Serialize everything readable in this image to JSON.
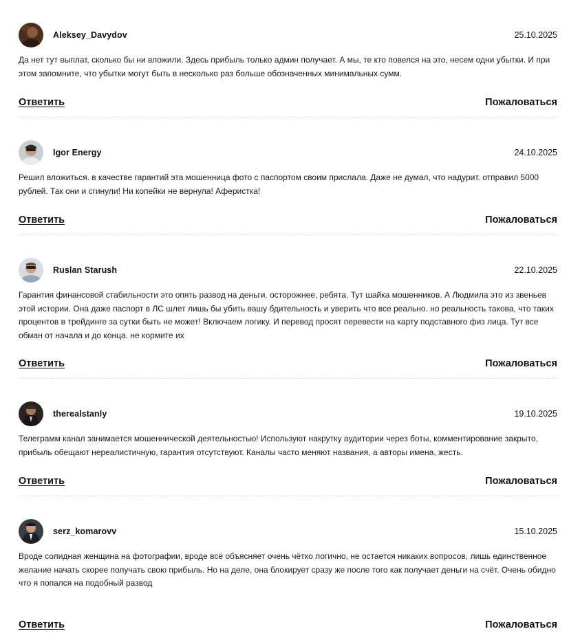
{
  "comments": [
    {
      "username": "Aleksey_Davydov",
      "date": "25.10.2025",
      "text": "Да нет тут выплат, сколько бы ни вложили. Здесь прибыль только админ получает. А мы, те кто повелся на это, несем одни убытки. И при этом запомните, что убытки могут быть в несколько раз больше обозначенных минимальных сумм.",
      "reply_label": "Ответить",
      "report_label": "Пожаловаться"
    },
    {
      "username": "Igor Energy",
      "date": "24.10.2025",
      "text": "Решил вложиться. в качестве гарантий эта мошенница фото с паспортом своим прислала. Даже не думал, что надурит. отправил 5000 рублей. Так они и сгинули! Ни копейки не вернула! Аферистка!",
      "reply_label": "Ответить",
      "report_label": "Пожаловаться"
    },
    {
      "username": "Ruslan Starush",
      "date": "22.10.2025",
      "text": "Гарантия финансовой стабильности это опять развод на деньги. осторожнее, ребята. Тут шайка мошенников. А Людмила это из звеньев этой истории. Она даже паспорт в ЛС шлет лишь бы убить вашу бдительность и уверить что все реально. но реальность такова, что таких процентов в трейдинге за сутки быть не может! Включаем логику. И перевод просят перевести на карту подставного физ лица. Тут все обман от начала и до конца. не кормите их",
      "reply_label": "Ответить",
      "report_label": "Пожаловаться"
    },
    {
      "username": "therealstanly",
      "date": "19.10.2025",
      "text": "Телеграмм канал занимается мошеннической деятельностью! Используют накрутку аудитории через боты, комментирование закрыто, прибыль обещают нереалистичную, гарантия отсутствуют. Каналы часто меняют названия, а авторы имена, жесть.",
      "reply_label": "Ответить",
      "report_label": "Пожаловаться"
    },
    {
      "username": "serz_komarovv",
      "date": "15.10.2025",
      "text": "Вроде солидная женщина на фотографии, вроде всё объясняет очень чётко логично, не остается никаких вопросов, лишь единственное желание начать скорее получать свою прибыль. Но на деле, она блокирует сразу же после того как получает деньги на счёт. Очень обидно что я попался на подобный развод",
      "reply_label": "Ответить",
      "report_label": "Пожаловаться"
    }
  ]
}
